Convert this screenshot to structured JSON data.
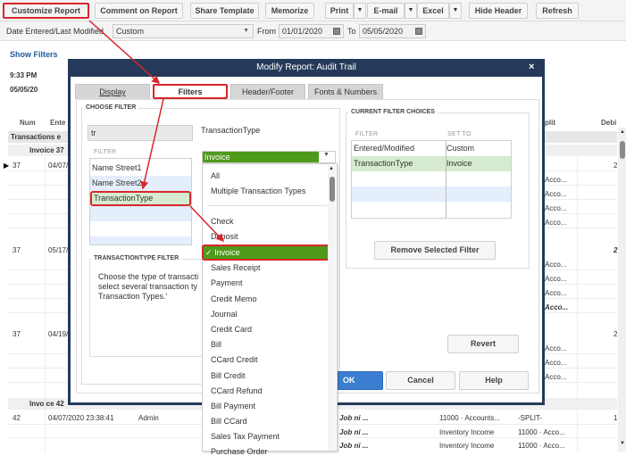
{
  "toolbar": {
    "customize_report": "Customize Report",
    "comment_on_report": "Comment on Report",
    "share_template": "Share Template",
    "memorize": "Memorize",
    "print": "Print",
    "email": "E-mail",
    "excel": "Excel",
    "hide_header": "Hide Header",
    "refresh": "Refresh",
    "dropdown_glyph": "▼"
  },
  "filterbar": {
    "date_label": "Date Entered/Last Modified",
    "date_range": "Custom",
    "from_label": "From",
    "from_value": "01/01/2020",
    "to_label": "To",
    "to_value": "05/05/2020"
  },
  "report": {
    "show_filters": "Show Filters",
    "time": "9:33 PM",
    "date": "05/05/20",
    "columns": [
      "Num",
      "Ente",
      "plit",
      "Debi"
    ],
    "group_header": "Transactions e",
    "groups": [
      {
        "label": "Invoice 37",
        "rows": [
          {
            "num": "37",
            "entered": "04/07/",
            "split": "",
            "debit": "2"
          },
          {
            "num": "",
            "entered": "",
            "split": "Acco...",
            "debit": ""
          },
          {
            "num": "",
            "entered": "",
            "split": "Acco...",
            "debit": ""
          },
          {
            "num": "",
            "entered": "",
            "split": "Acco...",
            "debit": ""
          },
          {
            "num": "",
            "entered": "",
            "split": "Acco...",
            "debit": ""
          },
          {
            "num": "37",
            "entered": "05/17/",
            "split": "",
            "debit": "2"
          },
          {
            "num": "",
            "entered": "",
            "split": "Acco...",
            "debit": ""
          },
          {
            "num": "",
            "entered": "",
            "split": "Acco...",
            "debit": ""
          },
          {
            "num": "",
            "entered": "",
            "split": "Acco...",
            "debit": ""
          },
          {
            "num": "",
            "entered": "",
            "split": "Acco...",
            "debit": ""
          },
          {
            "num": "37",
            "entered": "04/19/",
            "split": "",
            "debit": "2("
          },
          {
            "num": "",
            "entered": "",
            "split": "Acco...",
            "debit": ""
          },
          {
            "num": "",
            "entered": "",
            "split": "Acco...",
            "debit": ""
          },
          {
            "num": "",
            "entered": "",
            "split": "Acco...",
            "debit": ""
          }
        ]
      },
      {
        "label": "Invoice 42",
        "rows": [
          {
            "num": "42",
            "entered": "04/07/2020 23:38:41",
            "user": "Admin",
            "name": "Job ni ...",
            "account": "11000 · Accounts...",
            "split": "-SPLIT-",
            "debit": "1("
          },
          {
            "num": "",
            "entered": "",
            "user": "",
            "name": "Job ni ...",
            "account": "Inventory Income",
            "split": "11000 · Acco...",
            "debit": ""
          },
          {
            "num": "",
            "entered": "",
            "user": "",
            "name": "Job ni ...",
            "account": "Inventory Income",
            "split": "11000 · Acco...",
            "debit": ""
          }
        ]
      }
    ]
  },
  "dialog": {
    "title": "Modify Report: Audit Trail",
    "close": "×",
    "tabs": [
      {
        "label": "Display",
        "active": false
      },
      {
        "label": "Filters",
        "active": true
      },
      {
        "label": "Header/Footer",
        "active": false
      },
      {
        "label": "Fonts & Numbers",
        "active": false
      }
    ],
    "choose_filter": {
      "title": "CHOOSE FILTER",
      "search_value": "tr",
      "list_header": "FILTER",
      "items": [
        "Name Street1",
        "Name Street2",
        "TransactionType"
      ],
      "selected": "TransactionType"
    },
    "filter_label": "TransactionType",
    "combo_value": "Invoice",
    "dropdown": {
      "items_top": [
        "All",
        "Multiple Transaction Types"
      ],
      "items": [
        "Check",
        "Deposit",
        "Invoice",
        "Sales Receipt",
        "Payment",
        "Credit Memo",
        "Journal",
        "Credit Card",
        "Bill",
        "CCard Credit",
        "Bill Credit",
        "CCard Refund",
        "Bill Payment",
        "Bill CCard",
        "Sales Tax Payment",
        "Purchase Order"
      ],
      "selected": "Invoice",
      "check": "✓"
    },
    "description": {
      "title": "TRANSACTIONTYPE FILTER",
      "lines": [
        "Choose the type of transacti",
        "select several transaction ty",
        "Transaction Types.'"
      ]
    },
    "current_filters": {
      "title": "CURRENT FILTER CHOICES",
      "col_filter": "FILTER",
      "col_set_to": "SET TO",
      "rows": [
        {
          "filter": "Entered/Modified",
          "set_to": "Custom"
        },
        {
          "filter": "TransactionType",
          "set_to": "Invoice"
        }
      ],
      "remove_button": "Remove Selected Filter"
    },
    "revert": "Revert",
    "ok": "OK",
    "cancel": "Cancel",
    "help": "Help"
  },
  "colors": {
    "dialog_title_bg": "#253a5a",
    "highlight_red": "#d9262b",
    "selected_green": "#4e9a1a",
    "ok_blue": "#3b7dd0"
  }
}
